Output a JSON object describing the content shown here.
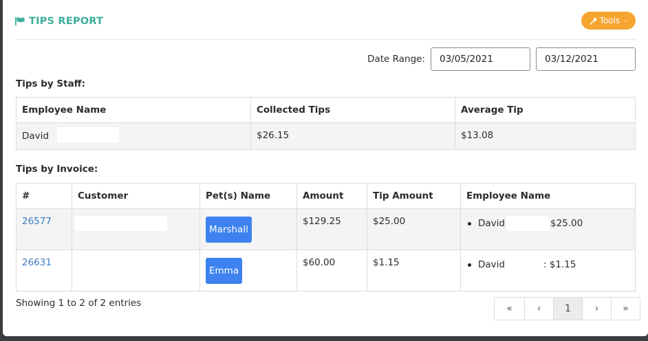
{
  "report": {
    "title": "TIPS REPORT",
    "tools_label": "Tools",
    "accent_color": "#3aaf9a",
    "tools_color": "#f7a531"
  },
  "date_range": {
    "label": "Date Range:",
    "start": "03/05/2021",
    "end": "03/12/2021"
  },
  "staff": {
    "title": "Tips by Staff:",
    "headers": [
      "Employee Name",
      "Collected Tips",
      "Average Tip"
    ],
    "rows": [
      {
        "employee": "David",
        "collected": "$26.15",
        "average": "$13.08"
      }
    ]
  },
  "invoices": {
    "title": "Tips by Invoice:",
    "headers": [
      "#",
      "Customer",
      "Pet(s) Name",
      "Amount",
      "Tip Amount",
      "Employee Name"
    ],
    "rows": [
      {
        "number": "26577",
        "customer": "",
        "pet": "Marshall",
        "amount": "$129.25",
        "tip": "$25.00",
        "employee": "David",
        "employee_tip": "$25.00"
      },
      {
        "number": "26631",
        "customer": "",
        "pet": "Emma",
        "amount": "$60.00",
        "tip": "$1.15",
        "employee": "David",
        "employee_tip": ": $1.15"
      }
    ]
  },
  "footer": {
    "entries_text": "Showing 1 to 2 of 2 entries",
    "pagination": {
      "first": "«",
      "prev": "‹",
      "current": "1",
      "next": "›",
      "last": "»"
    }
  },
  "icons": {
    "title_icon": "flag-icon",
    "tools_icon": "wrench-icon",
    "tools_caret": "chevron-down-icon",
    "pet_button_color": "#3d82ef",
    "link_color": "#3a7bc8"
  }
}
